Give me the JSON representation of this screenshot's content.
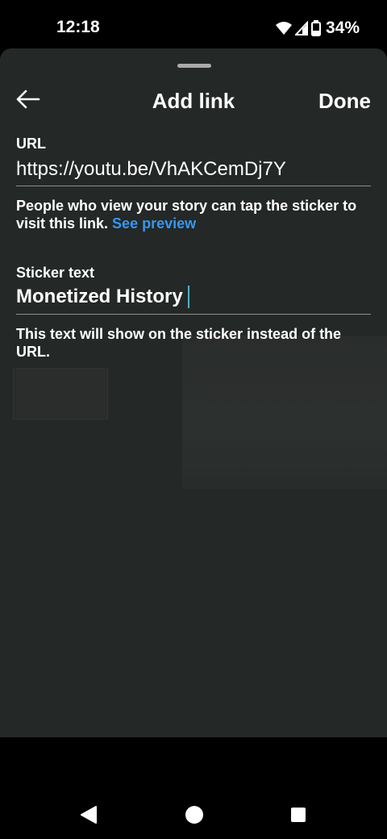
{
  "status_bar": {
    "time": "12:18",
    "battery": "34%",
    "icons": [
      "wifi-icon",
      "signal-icon",
      "battery-icon"
    ]
  },
  "header": {
    "title": "Add link",
    "back_icon": "back-arrow-icon",
    "done_label": "Done"
  },
  "url_field": {
    "label": "URL",
    "value": "https://youtu.be/VhAKCemDj7Y",
    "helper_text": "People who view your story can tap the sticker to visit this link.",
    "preview_link": "See preview"
  },
  "sticker_field": {
    "label": "Sticker text",
    "value": "Monetized History",
    "helper_text": "This text will show on the sticker instead of the URL."
  },
  "colors": {
    "sheet_background": "#242826",
    "link_blue": "#3797f0",
    "caret": "#4fb3c8"
  },
  "nav_bar": {
    "icons": [
      "back-triangle-icon",
      "home-circle-icon",
      "recents-square-icon"
    ]
  }
}
